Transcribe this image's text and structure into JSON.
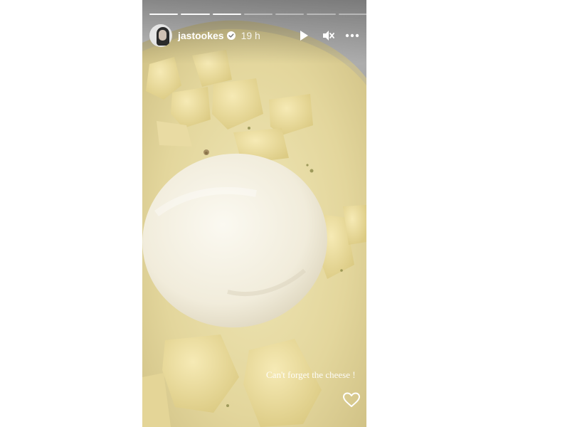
{
  "story": {
    "username": "jastookes",
    "verified": true,
    "time": "19 h",
    "progress": {
      "segments": 7,
      "completed": 3
    },
    "caption": "Can't forget the cheese !",
    "photo_description_icon": "photo-potato-soup-with-cheese"
  },
  "controls": {
    "play_icon": "play-icon",
    "mute_icon": "muted-speaker-icon",
    "more_icon": "more-options-icon",
    "like_icon": "heart-icon"
  },
  "colors": {
    "text": "#ffffff",
    "soup": "#e7dca6",
    "cheese": "#f4f0e2"
  }
}
